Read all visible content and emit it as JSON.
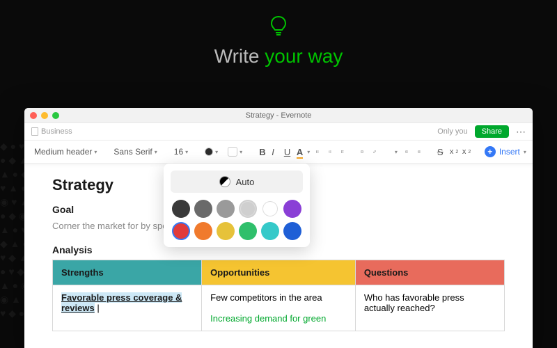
{
  "hero": {
    "line1": "Write ",
    "line2": "your way"
  },
  "window": {
    "title": "Strategy - Evernote",
    "notebook": "Business",
    "visibility": "Only you",
    "share_label": "Share"
  },
  "toolbar": {
    "heading": "Medium header",
    "font": "Sans Serif",
    "size": "16",
    "bold": "B",
    "italic": "I",
    "underline": "U",
    "textcolor": "A",
    "insert_label": "Insert"
  },
  "color_picker": {
    "auto_label": "Auto",
    "row1": [
      "#3a3a3a",
      "#6a6a6a",
      "#9a9a9a",
      "#cfcfcf",
      "#ffffff",
      "#3f68d6",
      "#8a3fd6"
    ],
    "row2": [
      "#e03b3b",
      "#f07a2d",
      "#e6c23a",
      "#2fbf6b",
      "#35c9c9",
      "#3a9be6",
      "#1f5fd6"
    ],
    "selected": "#e03b3b"
  },
  "document": {
    "title": "Strategy",
    "goal_heading": "Goal",
    "goal_text": "Corner the market for                                                               by specializing in modern, net-zero proj",
    "analysis_heading": "Analysis",
    "table": {
      "headers": [
        "Strengths",
        "Opportunities",
        "Questions"
      ],
      "rows": [
        {
          "strengths": "Favorable press coverage & reviews",
          "opportunities": "Few competitors in the area",
          "opportunities2": "Increasing demand for green",
          "questions": "Who has favorable press actually reached?"
        }
      ]
    }
  }
}
